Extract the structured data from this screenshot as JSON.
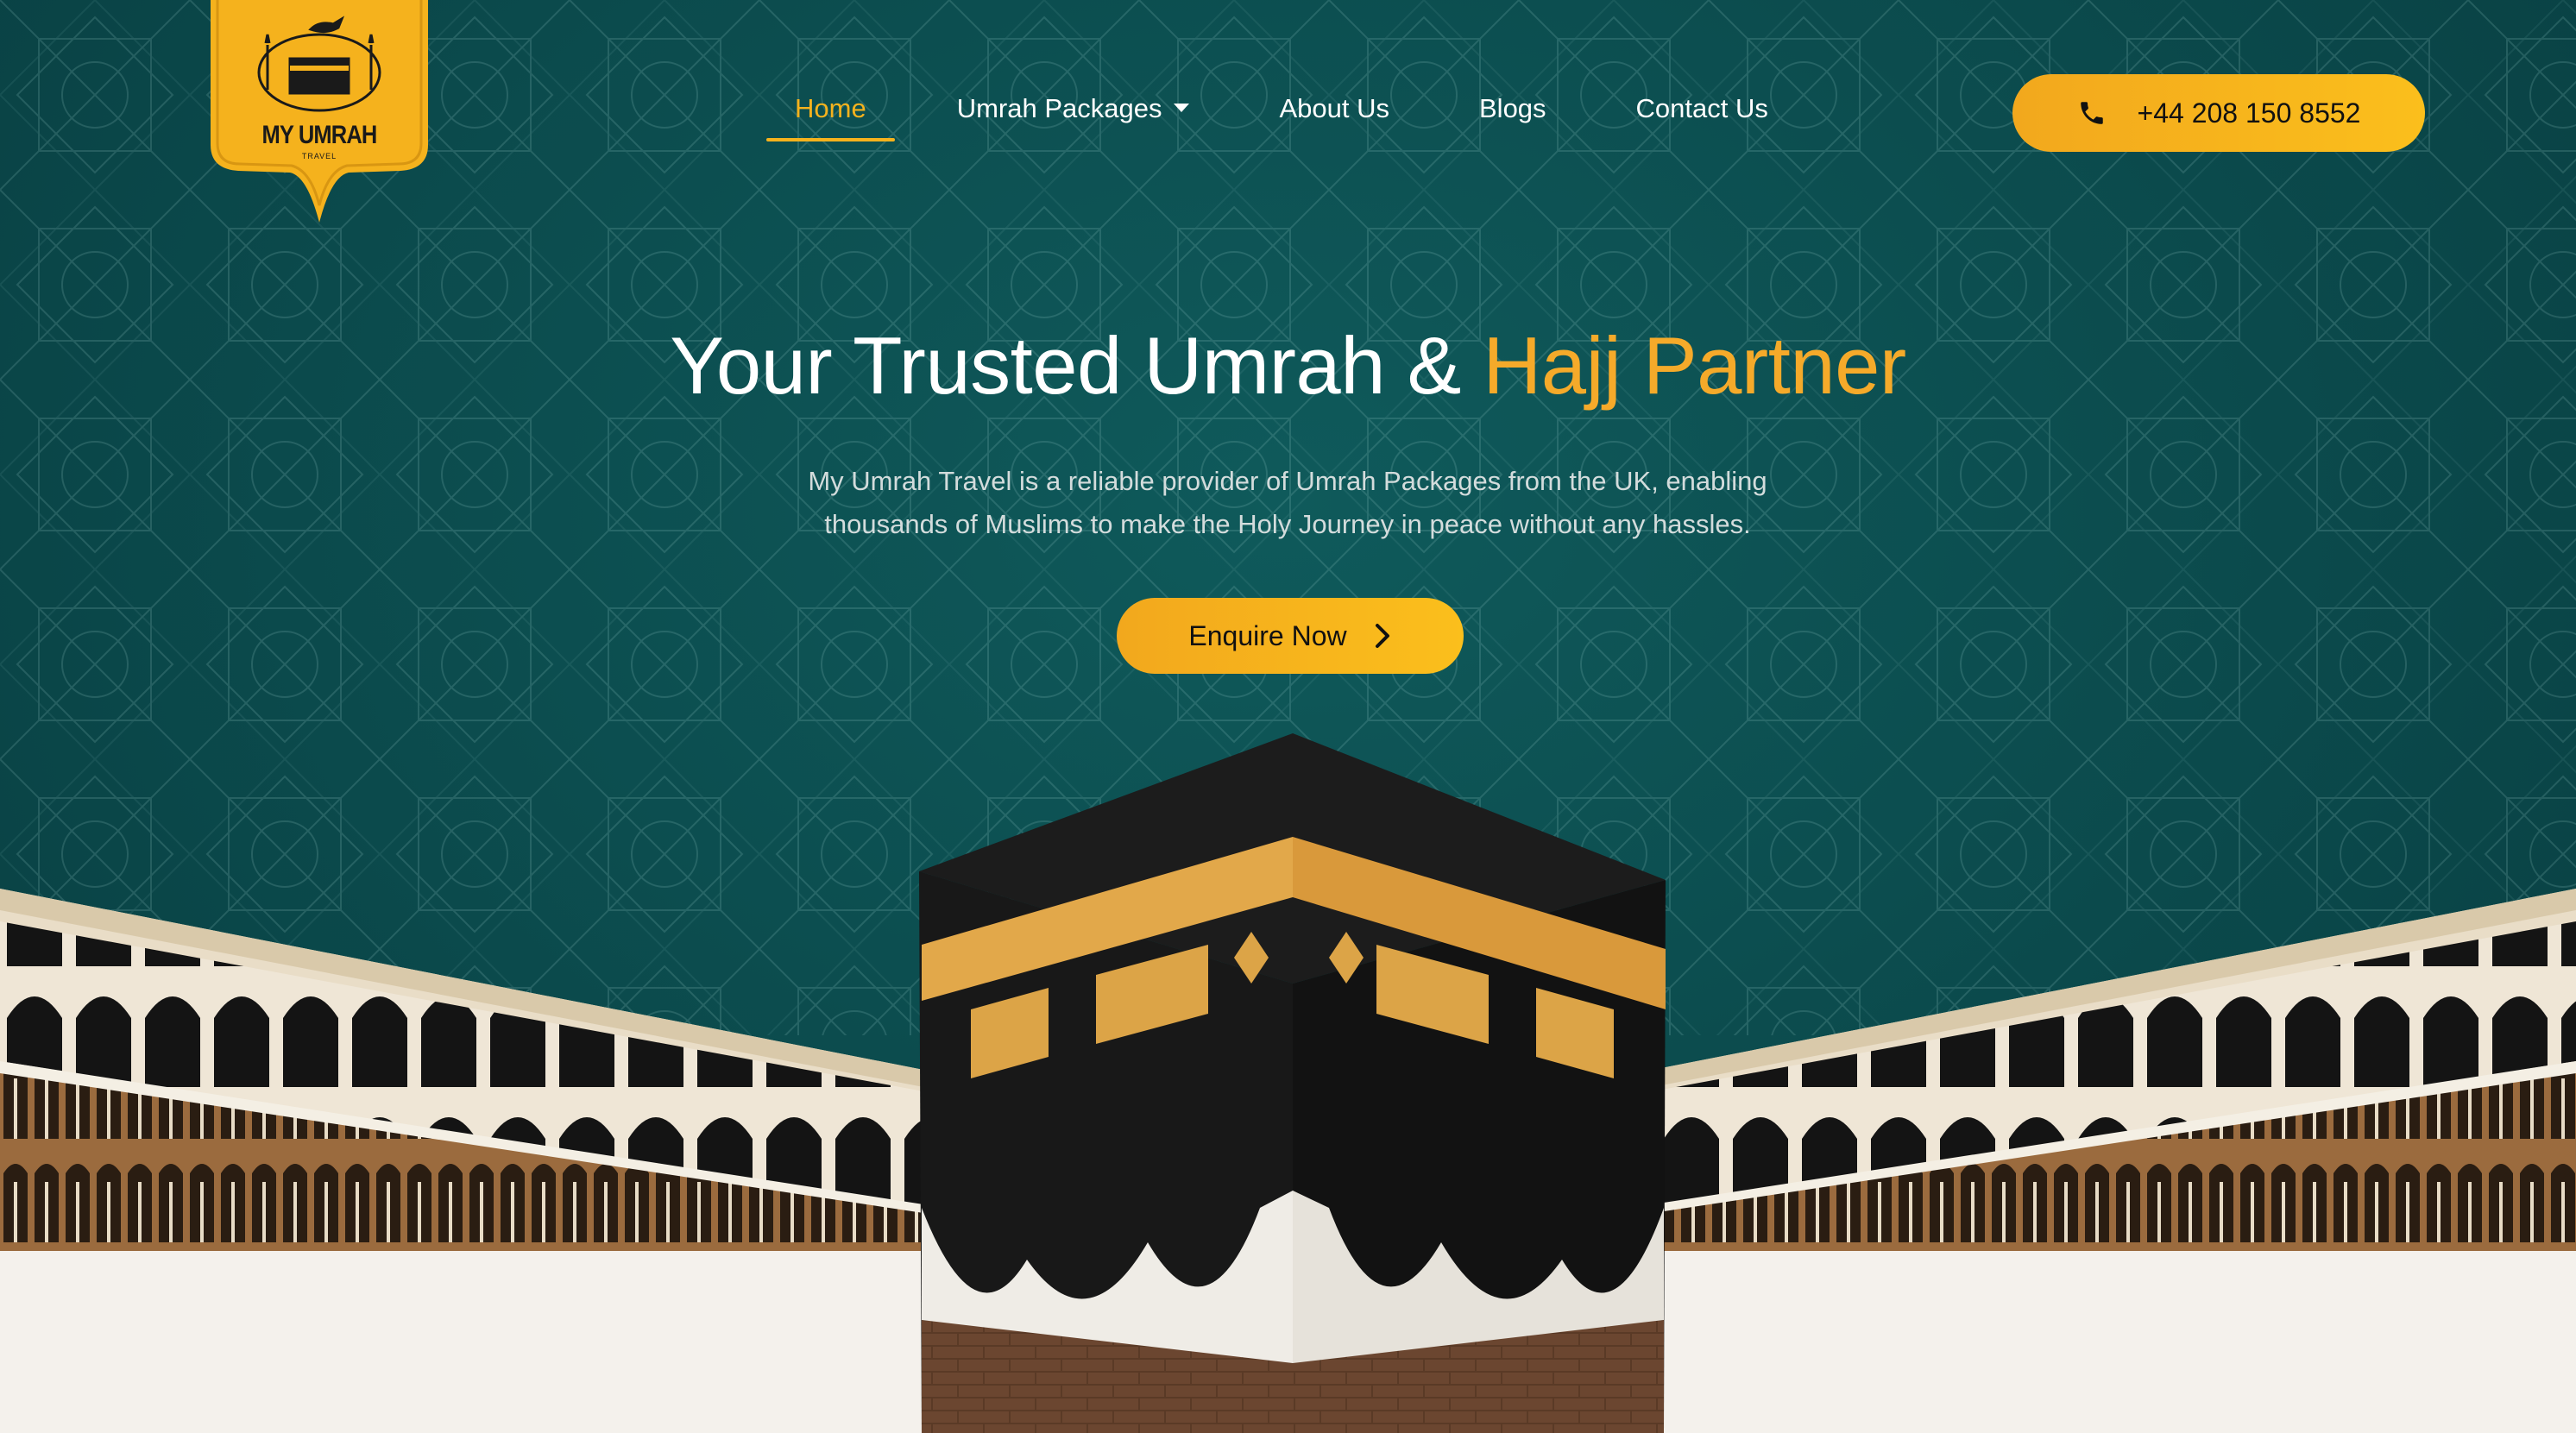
{
  "brand": {
    "logo_text": "MY UMRAH",
    "logo_subtext": "TRAVEL"
  },
  "nav": {
    "items": [
      {
        "label": "Home",
        "active": true
      },
      {
        "label": "Umrah Packages",
        "has_dropdown": true
      },
      {
        "label": "About Us"
      },
      {
        "label": "Blogs"
      },
      {
        "label": "Contact Us"
      }
    ]
  },
  "contact": {
    "phone_label": "+44 208 150 8552",
    "icon": "phone-icon"
  },
  "hero": {
    "title_main": "Your Trusted Umrah & ",
    "title_accent": "Hajj Partner",
    "description": "My Umrah Travel is a reliable provider of Umrah Packages from the UK, enabling thousands of Muslims to make the Holy Journey in peace without any hassles.",
    "cta_label": "Enquire Now",
    "cta_icon": "chevron-right-icon"
  },
  "colors": {
    "background": "#0b4a4c",
    "accent": "#f5b21d",
    "button": "#fbbf1c"
  }
}
